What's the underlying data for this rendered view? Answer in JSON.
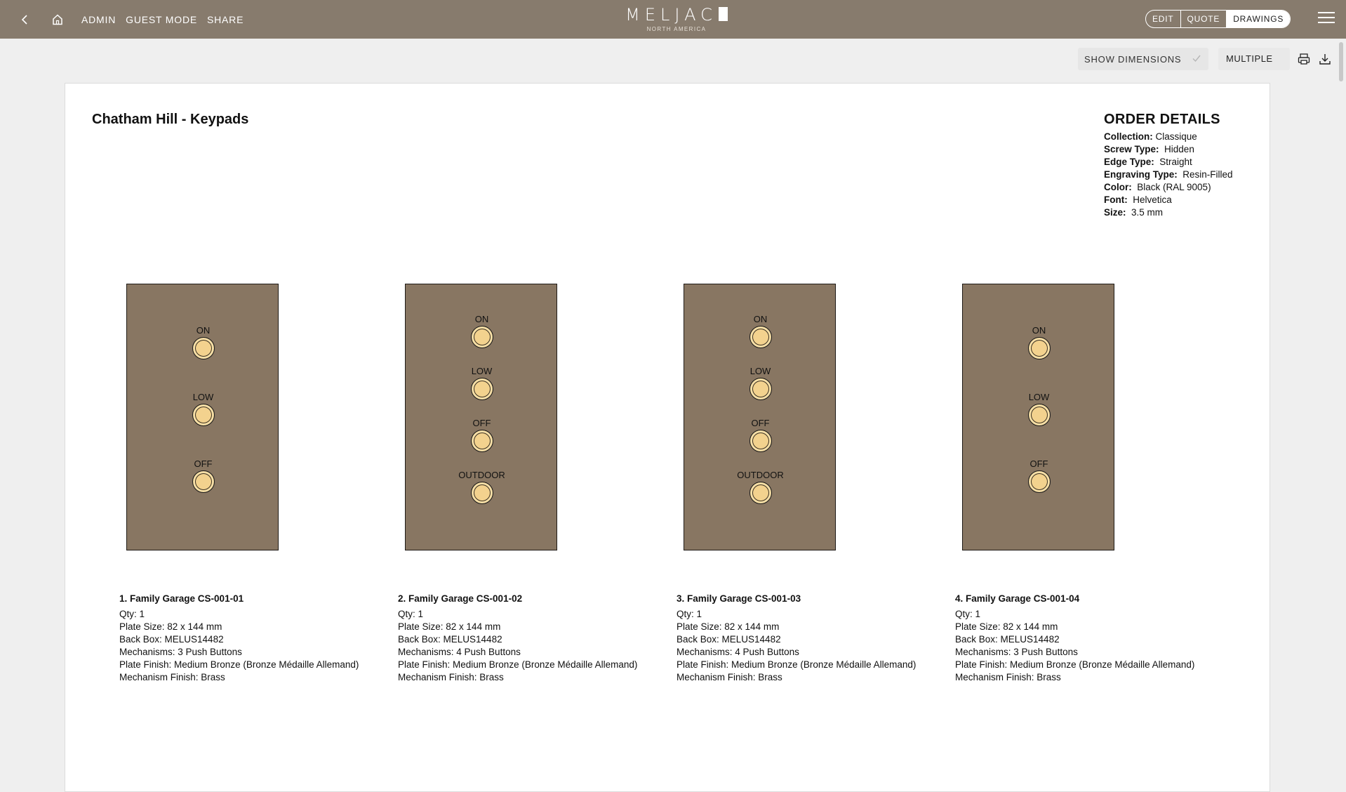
{
  "topbar": {
    "nav": [
      "ADMIN",
      "GUEST MODE",
      "SHARE"
    ],
    "brand_logo": "MELJAC",
    "brand_sub": "NORTH AMERICA",
    "modes": [
      "EDIT",
      "QUOTE",
      "DRAWINGS"
    ],
    "active_mode": "DRAWINGS"
  },
  "toolbar": {
    "show_dimensions_label": "SHOW DIMENSIONS",
    "multiple_label": "MULTIPLE"
  },
  "document": {
    "title": "Chatham Hill - Keypads",
    "order_details": {
      "heading": "ORDER DETAILS",
      "rows": [
        {
          "label": "Collection:",
          "value": "Classique"
        },
        {
          "label": "Screw Type:",
          "value": "Hidden"
        },
        {
          "label": "Edge Type:",
          "value": "Straight"
        },
        {
          "label": "Engraving Type:",
          "value": "Resin-Filled"
        },
        {
          "label": "Color:",
          "value": "Black (RAL 9005)"
        },
        {
          "label": "Font:",
          "value": "Helvetica"
        },
        {
          "label": "Size:",
          "value": "3.5 mm"
        }
      ]
    },
    "plates": [
      {
        "name": "1. Family Garage CS-001-01",
        "buttons": [
          "ON",
          "LOW",
          "OFF"
        ],
        "specs": [
          "Qty: 1",
          "Plate Size: 82 x 144 mm",
          "Back Box: MELUS14482",
          "Mechanisms: 3 Push Buttons",
          "Plate Finish: Medium Bronze (Bronze Médaille Allemand)",
          "Mechanism Finish: Brass"
        ]
      },
      {
        "name": "2. Family Garage CS-001-02",
        "buttons": [
          "ON",
          "LOW",
          "OFF",
          "OUTDOOR"
        ],
        "specs": [
          "Qty: 1",
          "Plate Size: 82 x 144 mm",
          "Back Box: MELUS14482",
          "Mechanisms: 4 Push Buttons",
          "Plate Finish: Medium Bronze (Bronze Médaille Allemand)",
          "Mechanism Finish: Brass"
        ]
      },
      {
        "name": "3. Family Garage CS-001-03",
        "buttons": [
          "ON",
          "LOW",
          "OFF",
          "OUTDOOR"
        ],
        "specs": [
          "Qty: 1",
          "Plate Size: 82 x 144 mm",
          "Back Box: MELUS14482",
          "Mechanisms: 4 Push Buttons",
          "Plate Finish: Medium Bronze (Bronze Médaille Allemand)",
          "Mechanism Finish: Brass"
        ]
      },
      {
        "name": "4. Family Garage CS-001-04",
        "buttons": [
          "ON",
          "LOW",
          "OFF"
        ],
        "specs": [
          "Qty: 1",
          "Plate Size: 82 x 144 mm",
          "Back Box: MELUS14482",
          "Mechanisms: 3 Push Buttons",
          "Plate Finish: Medium Bronze (Bronze Médaille Allemand)",
          "Mechanism Finish: Brass"
        ]
      }
    ]
  },
  "colors": {
    "topbar": "#877b6d",
    "plate_finish": "#887662",
    "button_brass": "#f3d28e"
  }
}
